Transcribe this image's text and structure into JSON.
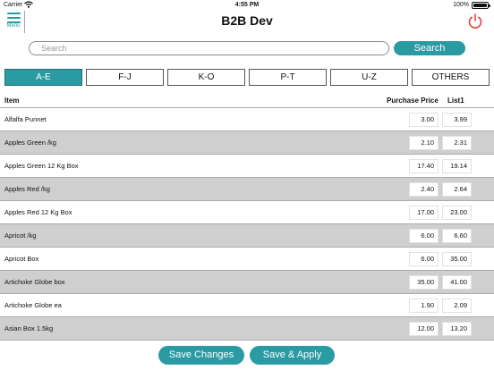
{
  "status_bar": {
    "carrier": "Carrier",
    "time": "4:55 PM",
    "battery": "100%"
  },
  "header": {
    "menu_label": "Menu",
    "title": "B2B Dev"
  },
  "search": {
    "placeholder": "Search",
    "button_label": "Search"
  },
  "letter_tabs": [
    {
      "label": "A-E",
      "active": true
    },
    {
      "label": "F-J",
      "active": false
    },
    {
      "label": "K-O",
      "active": false
    },
    {
      "label": "P-T",
      "active": false
    },
    {
      "label": "U-Z",
      "active": false
    },
    {
      "label": "OTHERS",
      "active": false
    }
  ],
  "columns": {
    "item": "Item",
    "purchase_price": "Purchase Price",
    "list1": "List1"
  },
  "rows": [
    {
      "name": "Alfalfa Punnet",
      "purchase_price": "3.00",
      "list1": "3.99"
    },
    {
      "name": "Apples Green /kg",
      "purchase_price": "2.10",
      "list1": "2.31"
    },
    {
      "name": "Apples Green 12 Kg Box",
      "purchase_price": "17.40",
      "list1": "19.14"
    },
    {
      "name": "Apples Red /kg",
      "purchase_price": "2.40",
      "list1": "2.64"
    },
    {
      "name": "Apples Red 12 Kg Box",
      "purchase_price": "17.00",
      "list1": "23.00"
    },
    {
      "name": "Apricot /kg",
      "purchase_price": "6.00",
      "list1": "6.60"
    },
    {
      "name": "Apricot Box",
      "purchase_price": "6.00",
      "list1": "35.00"
    },
    {
      "name": "Artichoke Globe box",
      "purchase_price": "35.00",
      "list1": "41.00"
    },
    {
      "name": "Artichoke Globe ea",
      "purchase_price": "1.90",
      "list1": "2.09"
    },
    {
      "name": "Asian Box 1.5kg",
      "purchase_price": "12.00",
      "list1": "13.20"
    }
  ],
  "actions": {
    "save_changes": "Save Changes",
    "save_apply": "Save & Apply"
  },
  "colors": {
    "accent": "#2a9aa3",
    "power": "#e8413a",
    "shaded_row": "#cfcfcf"
  }
}
